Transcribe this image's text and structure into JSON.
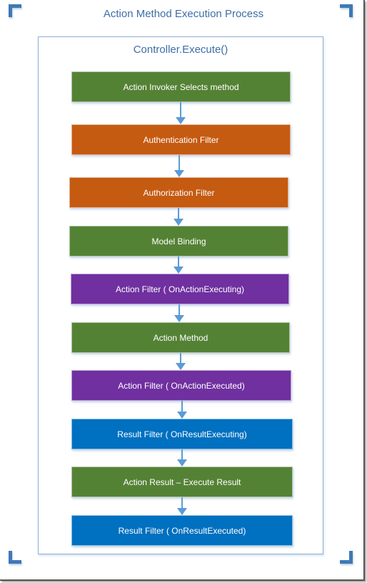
{
  "diagram": {
    "title": "Action Method Execution Process",
    "container_label": "Controller.Execute()",
    "colors": {
      "green": "#548235",
      "orange": "#c55a11",
      "purple": "#7030a0",
      "blue": "#0070c0",
      "arrow": "#5b9bd5",
      "title_text": "#3e6da8",
      "corner_bracket": "#3f79b5"
    },
    "steps": [
      {
        "label": "Action Invoker Selects method",
        "color": "#548235"
      },
      {
        "label": "Authentication Filter",
        "color": "#c55a11"
      },
      {
        "label": "Authorization Filter",
        "color": "#c55a11"
      },
      {
        "label": "Model Binding",
        "color": "#548235"
      },
      {
        "label": "Action Filter ( OnActionExecuting)",
        "color": "#7030a0"
      },
      {
        "label": "Action Method",
        "color": "#548235"
      },
      {
        "label": "Action Filter ( OnActionExecuted)",
        "color": "#7030a0"
      },
      {
        "label": "Result Filter ( OnResultExecuting)",
        "color": "#0070c0"
      },
      {
        "label": "Action Result – Execute Result",
        "color": "#548235"
      },
      {
        "label": "Result Filter ( OnResultExecuted)",
        "color": "#0070c0"
      }
    ],
    "connections": [
      {
        "from": 0,
        "to": 1
      },
      {
        "from": 1,
        "to": 2
      },
      {
        "from": 2,
        "to": 3
      },
      {
        "from": 3,
        "to": 4
      },
      {
        "from": 4,
        "to": 5
      },
      {
        "from": 5,
        "to": 6
      },
      {
        "from": 6,
        "to": 7
      },
      {
        "from": 7,
        "to": 8
      },
      {
        "from": 8,
        "to": 9
      }
    ]
  }
}
